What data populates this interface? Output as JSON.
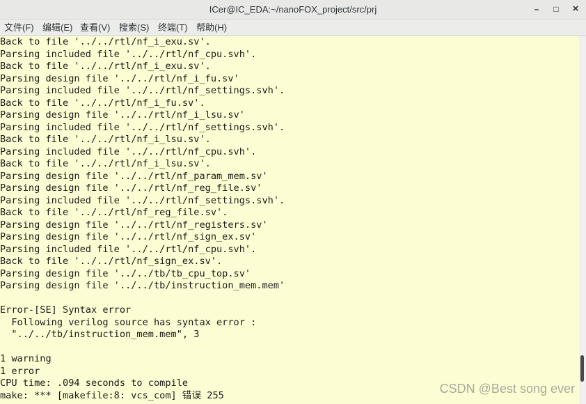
{
  "window": {
    "title": "ICer@IC_EDA:~/nanoFOX_project/src/prj",
    "controls": {
      "minimize": "–",
      "maximize": "□",
      "close": "×"
    }
  },
  "menu": [
    "文件(F)",
    "编辑(E)",
    "查看(V)",
    "搜索(S)",
    "终端(T)",
    "帮助(H)"
  ],
  "terminal_lines": [
    "Back to file '../../rtl/nf_i_exu.sv'.",
    "Parsing included file '../../rtl/nf_cpu.svh'.",
    "Back to file '../../rtl/nf_i_exu.sv'.",
    "Parsing design file '../../rtl/nf_i_fu.sv'",
    "Parsing included file '../../rtl/nf_settings.svh'.",
    "Back to file '../../rtl/nf_i_fu.sv'.",
    "Parsing design file '../../rtl/nf_i_lsu.sv'",
    "Parsing included file '../../rtl/nf_settings.svh'.",
    "Back to file '../../rtl/nf_i_lsu.sv'.",
    "Parsing included file '../../rtl/nf_cpu.svh'.",
    "Back to file '../../rtl/nf_i_lsu.sv'.",
    "Parsing design file '../../rtl/nf_param_mem.sv'",
    "Parsing design file '../../rtl/nf_reg_file.sv'",
    "Parsing included file '../../rtl/nf_settings.svh'.",
    "Back to file '../../rtl/nf_reg_file.sv'.",
    "Parsing design file '../../rtl/nf_registers.sv'",
    "Parsing design file '../../rtl/nf_sign_ex.sv'",
    "Parsing included file '../../rtl/nf_cpu.svh'.",
    "Back to file '../../rtl/nf_sign_ex.sv'.",
    "Parsing design file '../../tb/tb_cpu_top.sv'",
    "Parsing design file '../../tb/instruction_mem.mem'",
    "",
    "Error-[SE] Syntax error",
    "  Following verilog source has syntax error :",
    "  \"../../tb/instruction_mem.mem\", 3",
    "",
    "1 warning",
    "1 error",
    "CPU time: .094 seconds to compile",
    "make: *** [makefile:8: vcs_com] 错误 255"
  ],
  "watermark": "CSDN @Best song ever"
}
